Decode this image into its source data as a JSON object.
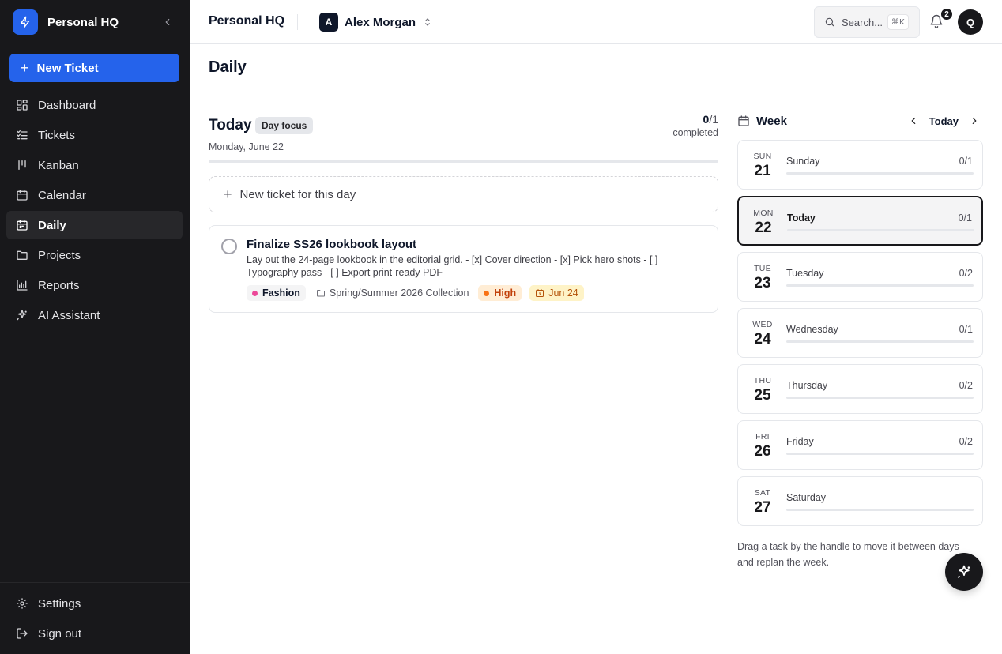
{
  "sidebar": {
    "brand": "Personal HQ",
    "new_ticket_label": "New Ticket",
    "items": [
      {
        "label": "Dashboard",
        "icon": "grid-icon"
      },
      {
        "label": "Tickets",
        "icon": "checklist-icon"
      },
      {
        "label": "Kanban",
        "icon": "kanban-icon"
      },
      {
        "label": "Calendar",
        "icon": "calendar-icon"
      },
      {
        "label": "Daily",
        "icon": "calendar-day-icon",
        "active": true
      },
      {
        "label": "Projects",
        "icon": "folder-icon"
      },
      {
        "label": "Reports",
        "icon": "bar-chart-icon"
      },
      {
        "label": "AI Assistant",
        "icon": "sparkles-icon"
      }
    ],
    "footer": [
      {
        "label": "Settings",
        "icon": "gear-icon"
      },
      {
        "label": "Sign out",
        "icon": "sign-out-icon"
      }
    ]
  },
  "header": {
    "title": "Personal HQ",
    "user_initial": "A",
    "user_name": "Alex Morgan",
    "search_placeholder": "Search...",
    "search_shortcut": "⌘K",
    "notification_count": "2",
    "avatar_initial": "Q"
  },
  "page": {
    "title": "Daily"
  },
  "today": {
    "title": "Today",
    "badge": "Day focus",
    "date": "Monday, June 22",
    "completed_count": "0",
    "total_count": "/1",
    "completed_label": "completed",
    "progress": 0,
    "new_ticket_label": "New ticket for this day",
    "tasks": [
      {
        "title": "Finalize SS26 lookbook layout",
        "description": "Lay out the 24-page lookbook in the editorial grid. - [x] Cover direction - [x] Pick hero shots - [ ] Typography pass - [ ] Export print-ready PDF",
        "tag": "Fashion",
        "tag_color": "#ec4899",
        "project": "Spring/Summer 2026 Collection",
        "priority": "High",
        "priority_color": "#f97316",
        "due": "Jun 24"
      }
    ]
  },
  "week": {
    "title": "Week",
    "today_label": "Today",
    "days": [
      {
        "abbr": "SUN",
        "num": "21",
        "name": "Sunday",
        "count": "0/1",
        "progress": 0
      },
      {
        "abbr": "MON",
        "num": "22",
        "name": "Today",
        "count": "0/1",
        "progress": 0,
        "current": true
      },
      {
        "abbr": "TUE",
        "num": "23",
        "name": "Tuesday",
        "count": "0/2",
        "progress": 0
      },
      {
        "abbr": "WED",
        "num": "24",
        "name": "Wednesday",
        "count": "0/1",
        "progress": 0
      },
      {
        "abbr": "THU",
        "num": "25",
        "name": "Thursday",
        "count": "0/2",
        "progress": 0
      },
      {
        "abbr": "FRI",
        "num": "26",
        "name": "Friday",
        "count": "0/2",
        "progress": 0
      },
      {
        "abbr": "SAT",
        "num": "27",
        "name": "Saturday",
        "count": "—",
        "progress": 0
      }
    ],
    "hint": "Drag a task by the handle to move it between days and replan the week."
  },
  "colors": {
    "accent": "#2563eb",
    "sidebar_bg": "#18181b"
  }
}
